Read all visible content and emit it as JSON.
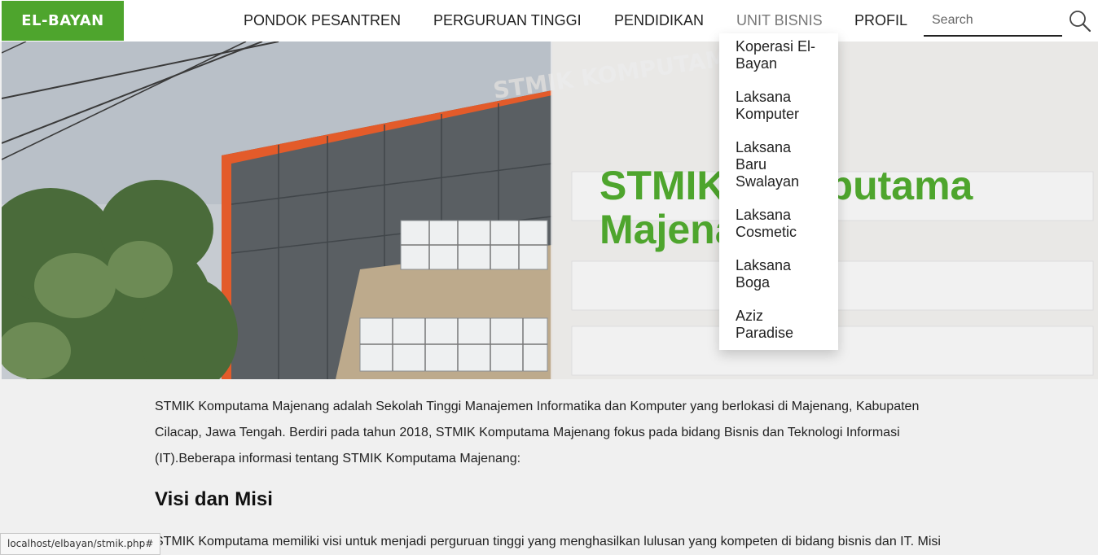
{
  "header": {
    "logo": "EL-BAYAN",
    "nav": [
      {
        "label": "PONDOK PESANTREN"
      },
      {
        "label": "PERGURUAN TINGGI"
      },
      {
        "label": "PENDIDIKAN"
      },
      {
        "label": "UNIT BISNIS"
      },
      {
        "label": "PROFIL"
      }
    ],
    "search": {
      "placeholder": "Search",
      "value": "",
      "icon": "search-icon"
    }
  },
  "dropdown": {
    "items": [
      {
        "label": "Koperasi El-Bayan"
      },
      {
        "label": "Laksana Komputer"
      },
      {
        "label": "Laksana Baru Swalayan"
      },
      {
        "label": "Laksana Cosmetic"
      },
      {
        "label": "Laksana Boga"
      },
      {
        "label": "Aziz Paradise"
      }
    ]
  },
  "hero": {
    "title": "STMIK Komputama Majenang",
    "building_sign": "STMIK KOMPUTAMA"
  },
  "content": {
    "intro": "STMIK Komputama Majenang adalah Sekolah Tinggi Manajemen Informatika dan Komputer yang berlokasi di Majenang, Kabupaten Cilacap, Jawa Tengah. Berdiri pada tahun 2018, STMIK Komputama Majenang fokus pada bidang Bisnis dan Teknologi Informasi (IT).Beberapa informasi tentang STMIK Komputama Majenang:",
    "heading": "Visi dan Misi",
    "visi_text": "STMIK Komputama memiliki visi untuk menjadi perguruan tinggi yang menghasilkan lulusan yang kompeten di bidang bisnis dan IT. Misi"
  },
  "status_bar": {
    "url": "localhost/elbayan/stmik.php#"
  },
  "colors": {
    "brand": "#4ea52d",
    "page_bg": "#f0f0f0",
    "text": "#222222"
  }
}
